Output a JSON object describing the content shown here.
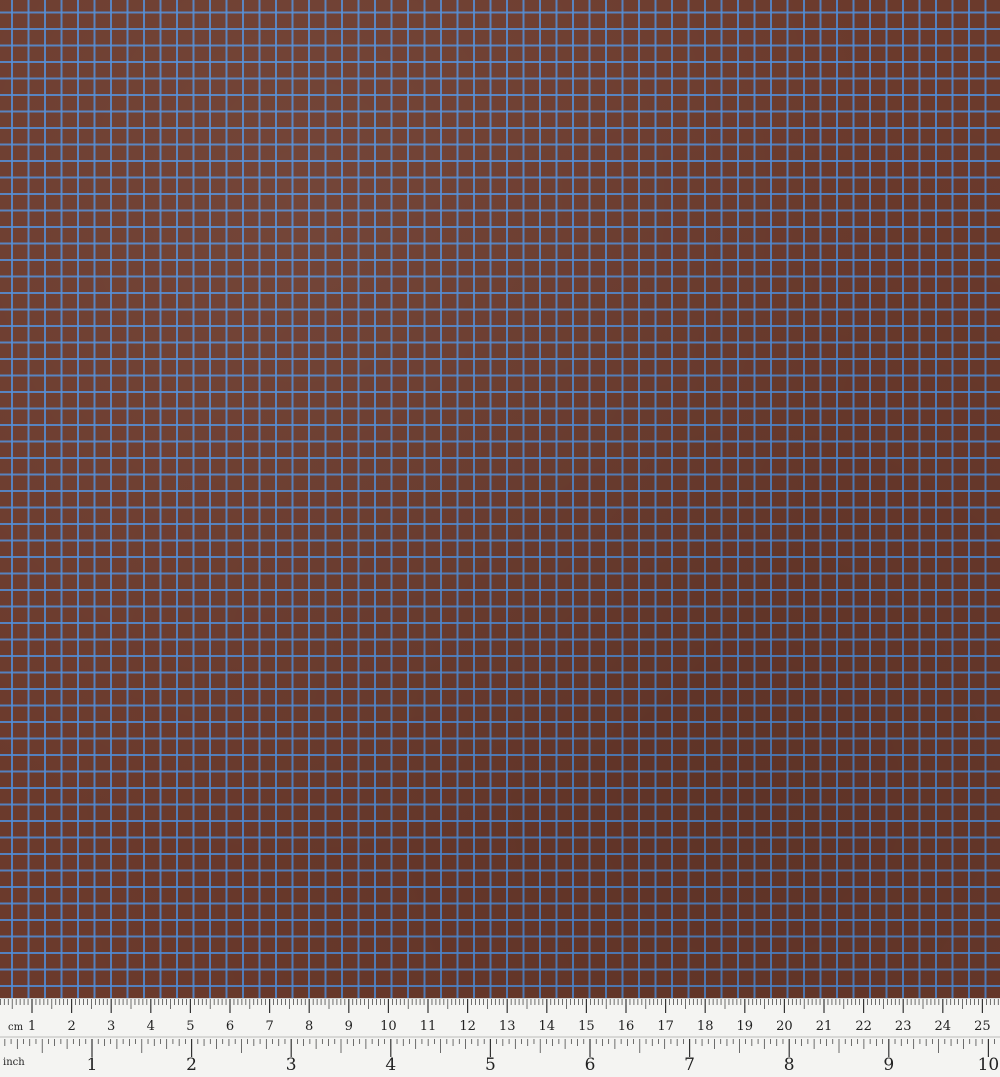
{
  "fabric": {
    "base_color": "#6b3a2c",
    "line_color": "#5090d8"
  },
  "ruler": {
    "cm_unit_label": "cm",
    "inch_unit_label": "inch",
    "cm_labels": [
      "1",
      "2",
      "3",
      "4",
      "5",
      "6",
      "7",
      "8",
      "9",
      "10",
      "11",
      "12",
      "13",
      "14",
      "15",
      "16",
      "17",
      "18",
      "19",
      "20",
      "21",
      "22",
      "23",
      "24",
      "25"
    ],
    "inch_labels": [
      "1",
      "2",
      "3",
      "4",
      "5",
      "6",
      "7",
      "8",
      "9",
      "10"
    ]
  }
}
